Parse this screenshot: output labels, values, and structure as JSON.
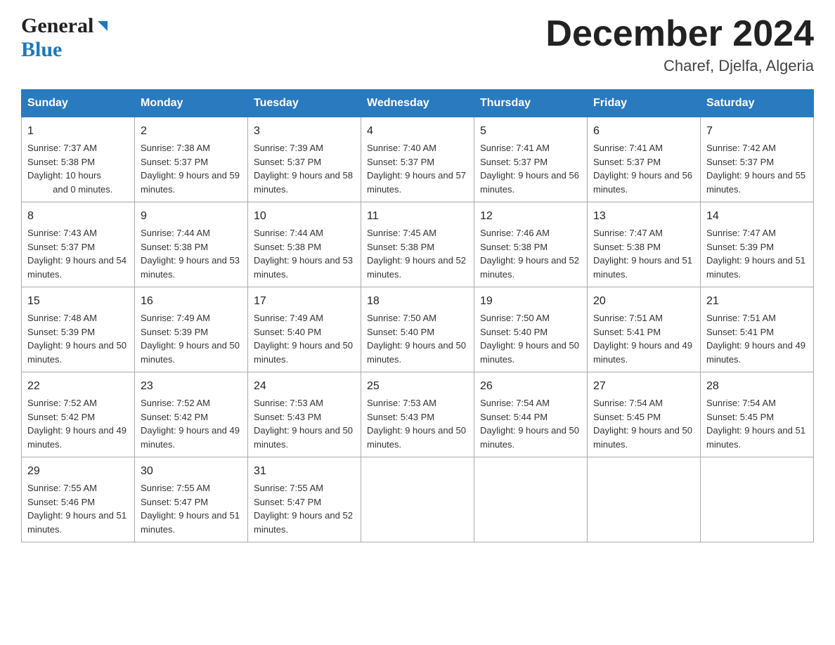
{
  "header": {
    "logo_general": "General",
    "logo_blue": "Blue",
    "month_title": "December 2024",
    "location": "Charef, Djelfa, Algeria"
  },
  "days_of_week": [
    "Sunday",
    "Monday",
    "Tuesday",
    "Wednesday",
    "Thursday",
    "Friday",
    "Saturday"
  ],
  "weeks": [
    [
      {
        "num": "1",
        "sunrise": "7:37 AM",
        "sunset": "5:38 PM",
        "daylight": "10 hours and 0 minutes."
      },
      {
        "num": "2",
        "sunrise": "7:38 AM",
        "sunset": "5:37 PM",
        "daylight": "9 hours and 59 minutes."
      },
      {
        "num": "3",
        "sunrise": "7:39 AM",
        "sunset": "5:37 PM",
        "daylight": "9 hours and 58 minutes."
      },
      {
        "num": "4",
        "sunrise": "7:40 AM",
        "sunset": "5:37 PM",
        "daylight": "9 hours and 57 minutes."
      },
      {
        "num": "5",
        "sunrise": "7:41 AM",
        "sunset": "5:37 PM",
        "daylight": "9 hours and 56 minutes."
      },
      {
        "num": "6",
        "sunrise": "7:41 AM",
        "sunset": "5:37 PM",
        "daylight": "9 hours and 56 minutes."
      },
      {
        "num": "7",
        "sunrise": "7:42 AM",
        "sunset": "5:37 PM",
        "daylight": "9 hours and 55 minutes."
      }
    ],
    [
      {
        "num": "8",
        "sunrise": "7:43 AM",
        "sunset": "5:37 PM",
        "daylight": "9 hours and 54 minutes."
      },
      {
        "num": "9",
        "sunrise": "7:44 AM",
        "sunset": "5:38 PM",
        "daylight": "9 hours and 53 minutes."
      },
      {
        "num": "10",
        "sunrise": "7:44 AM",
        "sunset": "5:38 PM",
        "daylight": "9 hours and 53 minutes."
      },
      {
        "num": "11",
        "sunrise": "7:45 AM",
        "sunset": "5:38 PM",
        "daylight": "9 hours and 52 minutes."
      },
      {
        "num": "12",
        "sunrise": "7:46 AM",
        "sunset": "5:38 PM",
        "daylight": "9 hours and 52 minutes."
      },
      {
        "num": "13",
        "sunrise": "7:47 AM",
        "sunset": "5:38 PM",
        "daylight": "9 hours and 51 minutes."
      },
      {
        "num": "14",
        "sunrise": "7:47 AM",
        "sunset": "5:39 PM",
        "daylight": "9 hours and 51 minutes."
      }
    ],
    [
      {
        "num": "15",
        "sunrise": "7:48 AM",
        "sunset": "5:39 PM",
        "daylight": "9 hours and 50 minutes."
      },
      {
        "num": "16",
        "sunrise": "7:49 AM",
        "sunset": "5:39 PM",
        "daylight": "9 hours and 50 minutes."
      },
      {
        "num": "17",
        "sunrise": "7:49 AM",
        "sunset": "5:40 PM",
        "daylight": "9 hours and 50 minutes."
      },
      {
        "num": "18",
        "sunrise": "7:50 AM",
        "sunset": "5:40 PM",
        "daylight": "9 hours and 50 minutes."
      },
      {
        "num": "19",
        "sunrise": "7:50 AM",
        "sunset": "5:40 PM",
        "daylight": "9 hours and 50 minutes."
      },
      {
        "num": "20",
        "sunrise": "7:51 AM",
        "sunset": "5:41 PM",
        "daylight": "9 hours and 49 minutes."
      },
      {
        "num": "21",
        "sunrise": "7:51 AM",
        "sunset": "5:41 PM",
        "daylight": "9 hours and 49 minutes."
      }
    ],
    [
      {
        "num": "22",
        "sunrise": "7:52 AM",
        "sunset": "5:42 PM",
        "daylight": "9 hours and 49 minutes."
      },
      {
        "num": "23",
        "sunrise": "7:52 AM",
        "sunset": "5:42 PM",
        "daylight": "9 hours and 49 minutes."
      },
      {
        "num": "24",
        "sunrise": "7:53 AM",
        "sunset": "5:43 PM",
        "daylight": "9 hours and 50 minutes."
      },
      {
        "num": "25",
        "sunrise": "7:53 AM",
        "sunset": "5:43 PM",
        "daylight": "9 hours and 50 minutes."
      },
      {
        "num": "26",
        "sunrise": "7:54 AM",
        "sunset": "5:44 PM",
        "daylight": "9 hours and 50 minutes."
      },
      {
        "num": "27",
        "sunrise": "7:54 AM",
        "sunset": "5:45 PM",
        "daylight": "9 hours and 50 minutes."
      },
      {
        "num": "28",
        "sunrise": "7:54 AM",
        "sunset": "5:45 PM",
        "daylight": "9 hours and 51 minutes."
      }
    ],
    [
      {
        "num": "29",
        "sunrise": "7:55 AM",
        "sunset": "5:46 PM",
        "daylight": "9 hours and 51 minutes."
      },
      {
        "num": "30",
        "sunrise": "7:55 AM",
        "sunset": "5:47 PM",
        "daylight": "9 hours and 51 minutes."
      },
      {
        "num": "31",
        "sunrise": "7:55 AM",
        "sunset": "5:47 PM",
        "daylight": "9 hours and 52 minutes."
      },
      {
        "num": "",
        "sunrise": "",
        "sunset": "",
        "daylight": ""
      },
      {
        "num": "",
        "sunrise": "",
        "sunset": "",
        "daylight": ""
      },
      {
        "num": "",
        "sunrise": "",
        "sunset": "",
        "daylight": ""
      },
      {
        "num": "",
        "sunrise": "",
        "sunset": "",
        "daylight": ""
      }
    ]
  ],
  "labels": {
    "sunrise": "Sunrise:",
    "sunset": "Sunset:",
    "daylight": "Daylight:"
  }
}
